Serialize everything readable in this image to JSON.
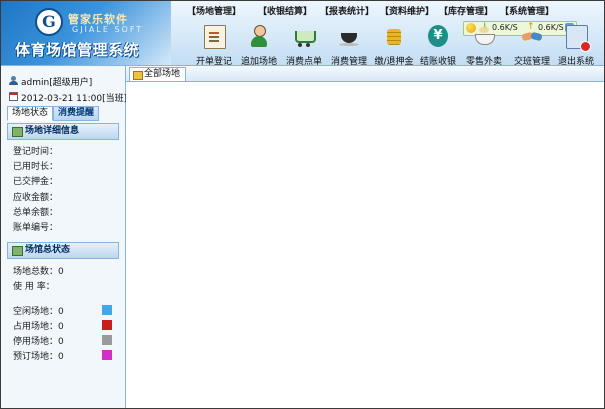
{
  "header": {
    "company_name": "管家乐软件",
    "company_en": "GJIALE SOFT",
    "logo_letter": "G",
    "app_title": "体育场馆管理系统"
  },
  "menu": {
    "items": [
      {
        "label": "【场地管理】"
      },
      {
        "label": "【收银结算】"
      },
      {
        "label": "【报表统计】"
      },
      {
        "label": "【资料维护】"
      },
      {
        "label": "【库存管理】"
      },
      {
        "label": "【系统管理】"
      }
    ]
  },
  "network": {
    "down": "0.6K/S",
    "up": "0.6K/S"
  },
  "toolbar": {
    "items": [
      {
        "label": "开单登记",
        "icon": "document-pen-icon"
      },
      {
        "label": "追加场地",
        "icon": "person-icon"
      },
      {
        "label": "消费点单",
        "icon": "cart-icon"
      },
      {
        "label": "消费管理",
        "icon": "coffee-cup-icon"
      },
      {
        "label": "缴/退押金",
        "icon": "coins-icon"
      },
      {
        "label": "结账收银",
        "icon": "yen-icon"
      },
      {
        "label": "零售外卖",
        "icon": "bowl-icon"
      },
      {
        "label": "交班管理",
        "icon": "handshake-icon"
      },
      {
        "label": "退出系统",
        "icon": "exit-icon"
      }
    ]
  },
  "sidebar": {
    "user": "admin[超级用户]",
    "datetime": "2012-03-21 11:00[当班]",
    "tabs": {
      "status": "场地状态",
      "reminder": "消费提醒"
    },
    "detail_title": "场地详细信息",
    "detail_fields": {
      "login_time": "登记时间：",
      "used_time": "已用时长：",
      "deposit": "已交押金：",
      "amount_due": "应收金额：",
      "balance": "总单余额：",
      "bill_no": "账单编号："
    },
    "overall_title": "场馆总状态",
    "totals": {
      "total": "场地总数：0",
      "usage": "使 用 率："
    },
    "legend": [
      {
        "label": "空闲场地：0",
        "color": "#3fa9e8"
      },
      {
        "label": "占用场地：0",
        "color": "#c81e1e"
      },
      {
        "label": "停用场地：0",
        "color": "#9a9a9a"
      },
      {
        "label": "预订场地：0",
        "color": "#d42ec8"
      }
    ]
  },
  "main": {
    "tab_label": "全部场地"
  }
}
